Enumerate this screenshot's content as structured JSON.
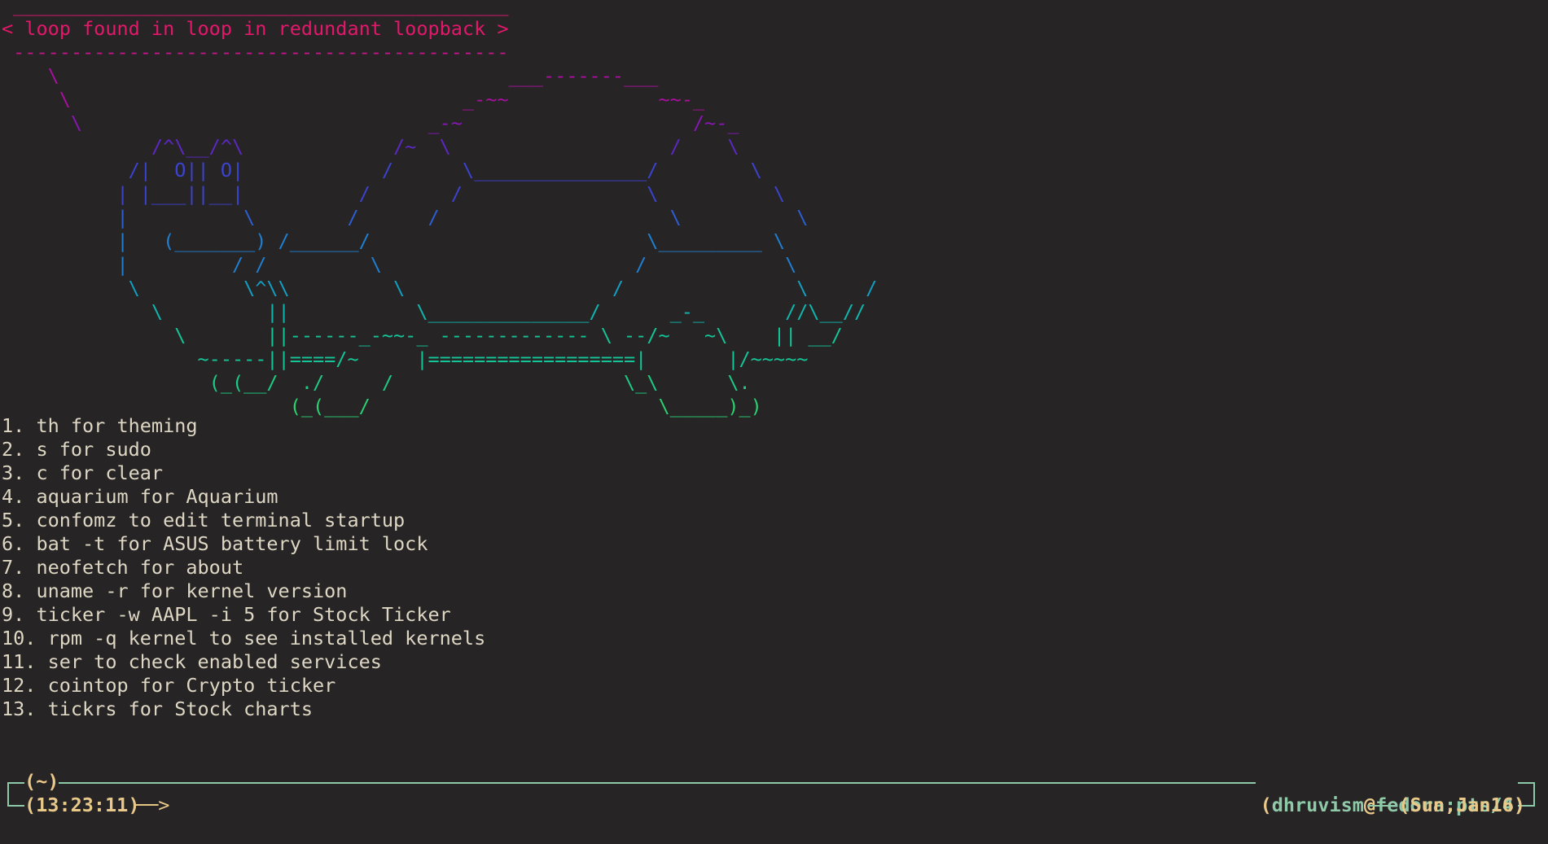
{
  "colors": {
    "background": "#272426",
    "text": "#ded7c4",
    "prompt_line": "#8ec9a8",
    "prompt_text": "#e9c98a",
    "user": "#8ec9a8",
    "at": "#e9c98a",
    "host": "#8ec9a8",
    "gradient": [
      "#e3186b",
      "#c5148a",
      "#a8109f",
      "#8617b2",
      "#5c28c3",
      "#3b43cf",
      "#2c5fd2",
      "#1f7fd0",
      "#119fc3",
      "#0fb6ae",
      "#13c597",
      "#1dcc84",
      "#2bd071"
    ]
  },
  "ascii_art": [
    " ___________________________________________",
    "< loop found in loop in redundant loopback >",
    " -------------------------------------------",
    "    \\                                       ___-------___",
    "     \\                                  _-~~             ~~-_",
    "      \\                              _-~                    /~-_",
    "             /^\\__/^\\             /~  \\                   /    \\",
    "           /|  O|| O|            /      \\_______________/        \\",
    "          | |___||__|          /       /                \\          \\",
    "          |          \\        /      /                    \\          \\",
    "          |   (_______) /______/                        \\_________ \\",
    "          |         / /         \\                      /            \\",
    "           \\         \\^\\\\         \\                  /               \\     /",
    "             \\         ||           \\______________/      _-_       //\\__//",
    "               \\       ||------_-~~-_ ------------- \\ --/~   ~\\    || __/",
    "                 ~-----||====/~     |==================|       |/~~~~~",
    "                  (_(__/  ./     /                    \\_\\      \\.",
    "                         (_(___/                         \\_____)_)"
  ],
  "menu": [
    "1. th for theming",
    "2. s for sudo",
    "3. c for clear",
    "4. aquarium for Aquarium",
    "5. confomz to edit terminal startup",
    "6. bat -t for ASUS battery limit lock",
    "7. neofetch for about",
    "8. uname -r for kernel version",
    "9. ticker -w AAPL -i 5 for Stock Ticker",
    "10. rpm -q kernel to see installed kernels",
    "11. ser to check enabled services",
    "12. cointop for Crypto ticker",
    "13. tickrs for Stock charts"
  ],
  "prompt": {
    "cwd": "(~)",
    "time": "(13:23:11)",
    "arrow": "──>",
    "user": "dhruvism",
    "at": "@",
    "host": "fedora:pts/4",
    "date": "(Sun,Jan16)"
  }
}
